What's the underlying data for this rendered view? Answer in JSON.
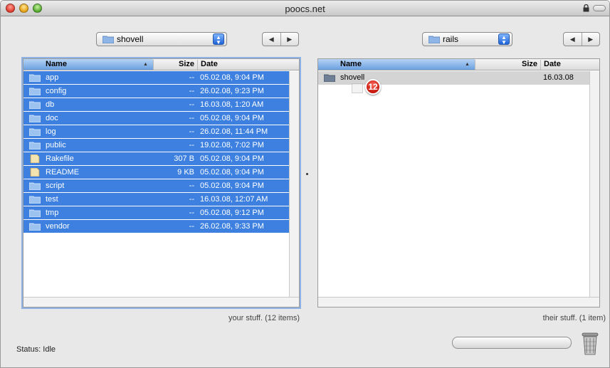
{
  "window": {
    "title": "poocs.net"
  },
  "left": {
    "folder": "shovell",
    "columns": {
      "name": "Name",
      "size": "Size",
      "date": "Date"
    },
    "files": [
      {
        "name": "app",
        "size": "--",
        "date": "05.02.08, 9:04 PM",
        "kind": "folder"
      },
      {
        "name": "config",
        "size": "--",
        "date": "26.02.08, 9:23 PM",
        "kind": "folder"
      },
      {
        "name": "db",
        "size": "--",
        "date": "16.03.08, 1:20 AM",
        "kind": "folder"
      },
      {
        "name": "doc",
        "size": "--",
        "date": "05.02.08, 9:04 PM",
        "kind": "folder"
      },
      {
        "name": "log",
        "size": "--",
        "date": "26.02.08, 11:44 PM",
        "kind": "folder"
      },
      {
        "name": "public",
        "size": "--",
        "date": "19.02.08, 7:02 PM",
        "kind": "folder"
      },
      {
        "name": "Rakefile",
        "size": "307 B",
        "date": "05.02.08, 9:04 PM",
        "kind": "file"
      },
      {
        "name": "README",
        "size": "9 KB",
        "date": "05.02.08, 9:04 PM",
        "kind": "file"
      },
      {
        "name": "script",
        "size": "--",
        "date": "05.02.08, 9:04 PM",
        "kind": "folder"
      },
      {
        "name": "test",
        "size": "--",
        "date": "16.03.08, 12:07 AM",
        "kind": "folder"
      },
      {
        "name": "tmp",
        "size": "--",
        "date": "05.02.08, 9:12 PM",
        "kind": "folder"
      },
      {
        "name": "vendor",
        "size": "--",
        "date": "26.02.08, 9:33 PM",
        "kind": "folder"
      }
    ],
    "caption": "your stuff. (12 items)"
  },
  "right": {
    "folder": "rails",
    "columns": {
      "name": "Name",
      "size": "Size",
      "date": "Date"
    },
    "files": [
      {
        "name": "shovell",
        "size": "",
        "date": "16.03.08",
        "kind": "folder"
      }
    ],
    "caption": "their stuff. (1 item)",
    "drag_badge": "12"
  },
  "nav": {
    "back": "◀",
    "forward": "▶"
  },
  "status": "Status: Idle",
  "colors": {
    "selection": "#3d80df",
    "header_sort": "#6aa0e0",
    "badge": "#c4170c"
  },
  "icons": [
    "folder-icon",
    "file-icon",
    "lock-icon",
    "trash-icon"
  ]
}
